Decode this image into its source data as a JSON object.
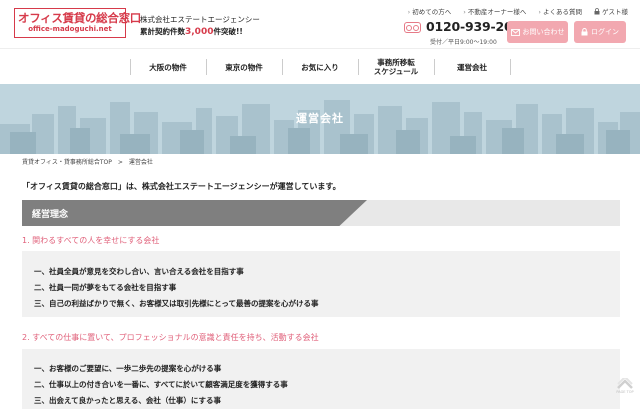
{
  "header": {
    "logo_title": "オフィス賃貸の総合窓口",
    "logo_sub": "office-madoguchi.net",
    "company": "株式会社エステートエージェンシー",
    "contracts_prefix": "累計契約件数",
    "contracts_num": "3,000",
    "contracts_suffix": "件突破!!",
    "links": [
      {
        "label": "初めての方へ",
        "icon": "chevron-right-icon"
      },
      {
        "label": "不動産オーナー様へ",
        "icon": "chevron-right-icon"
      },
      {
        "label": "よくある質問",
        "icon": "chevron-right-icon"
      },
      {
        "label": "ゲスト様",
        "icon": "lock-icon"
      }
    ],
    "phone": "0120-939-204",
    "hours": "受付／平日9:00〜19:00",
    "contact_label": "お問い合わせ",
    "login_label": "ログイン"
  },
  "nav": [
    "大阪の物件",
    "東京の物件",
    "お気に入り",
    "事務所移転\nスケジュール",
    "運営会社"
  ],
  "banner": {
    "title": "運営会社"
  },
  "breadcrumb": {
    "home": "賃貸オフィス・貸事務所総合TOP",
    "sep": ">",
    "current": "運営会社"
  },
  "intro": "「オフィス賃貸の総合窓口」は、株式会社エステートエージェンシーが運営しています。",
  "section": {
    "title": "経営理念"
  },
  "philosophy": [
    {
      "heading": "1.  関わるすべての人を幸せにする会社",
      "items": [
        "一、社員全員が意見を交わし合い、言い合える会社を目指す事",
        "二、社員一同が夢をもてる会社を目指す事",
        "三、自己の利益ばかりで無く、お客様又は取引先様にとって最善の提案を心がける事"
      ]
    },
    {
      "heading": "2.  すべての仕事に置いて、プロフェッショナルの意識と責任を持ち、活動する会社",
      "items": [
        "一、お客様のご要望に、一歩二歩先の提案を心がける事",
        "二、仕事以上の付き合いを一番に、すべてに於いて顧客満足度を獲得する事",
        "三、出会えて良かったと思える、会社（仕事）にする事"
      ]
    }
  ],
  "pagetop": "PAGE TOP",
  "colors": {
    "accent": "#d63a4a",
    "heading_pink": "#e0607a",
    "button_pink": "#f2a8b0",
    "section_gray": "#7f7f7f",
    "banner_sky": "#bcd3dc"
  }
}
